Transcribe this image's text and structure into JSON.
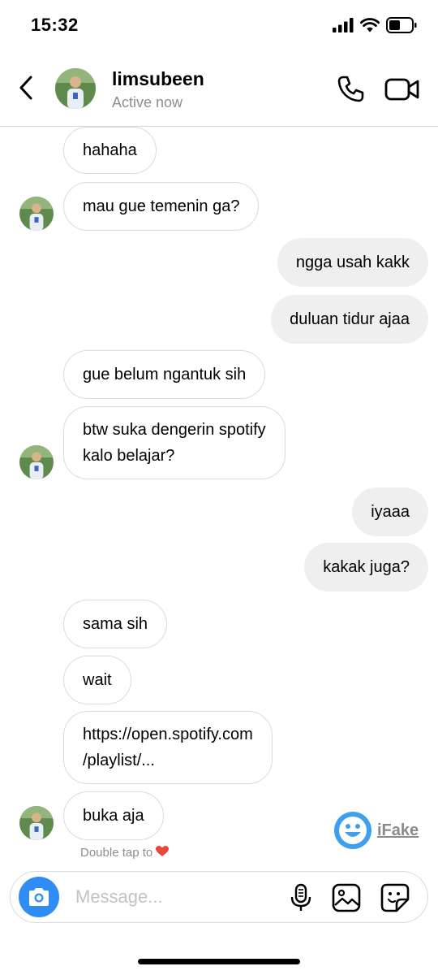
{
  "status": {
    "time": "15:32"
  },
  "header": {
    "name": "limsubeen",
    "status": "Active now"
  },
  "messages": [
    {
      "text": "hahaha",
      "direction": "incoming"
    },
    {
      "text": "mau gue temenin ga?",
      "direction": "incoming"
    },
    {
      "text": "ngga usah kakk",
      "direction": "outgoing"
    },
    {
      "text": "duluan tidur ajaa",
      "direction": "outgoing"
    },
    {
      "text": "gue belum ngantuk sih",
      "direction": "incoming"
    },
    {
      "text": "btw suka dengerin spotify",
      "text2": "kalo belajar?",
      "direction": "incoming"
    },
    {
      "text": "iyaaa",
      "direction": "outgoing"
    },
    {
      "text": "kakak juga?",
      "direction": "outgoing"
    },
    {
      "text": "sama sih",
      "direction": "incoming"
    },
    {
      "text": "wait",
      "direction": "incoming"
    },
    {
      "text": "https://open.spotify.com",
      "text2": "/playlist/...",
      "direction": "incoming"
    },
    {
      "text": "buka aja",
      "direction": "incoming"
    }
  ],
  "hint": {
    "text": "Double tap to",
    "icon": "heart-icon"
  },
  "watermark": {
    "label": "iFake"
  },
  "composer": {
    "placeholder": "Message..."
  },
  "colors": {
    "accent": "#2e8ef5",
    "incoming_border": "#dbdbdb",
    "outgoing_bg": "#efefef",
    "secondary_text": "#8e8e8e",
    "heart": "#e8473b"
  }
}
